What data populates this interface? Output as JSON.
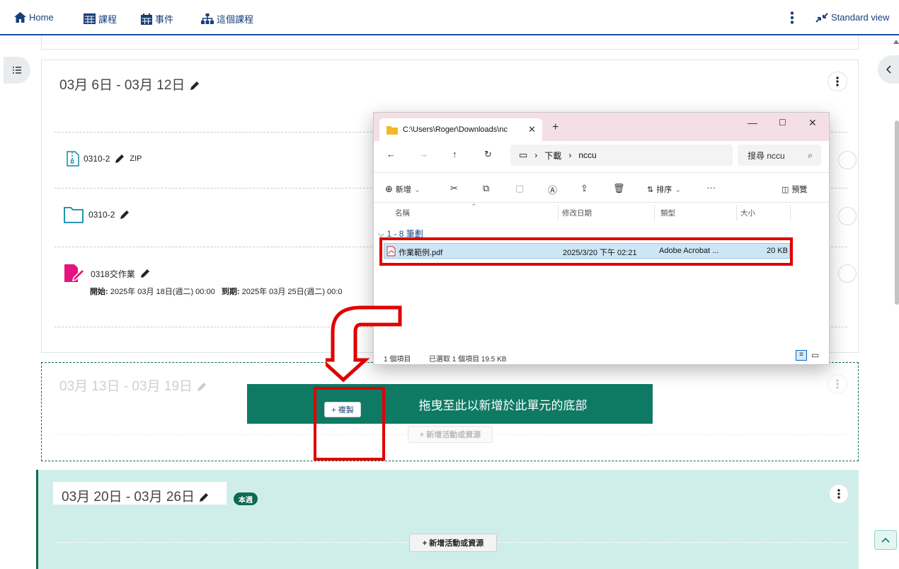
{
  "nav": {
    "home": "Home",
    "courses": "課程",
    "events": "事件",
    "this_course": "這個課程",
    "standard_view": "Standard view"
  },
  "sections": {
    "s1": {
      "title": "03月 6日 - 03月 12日",
      "activities": [
        {
          "name": "0310-2",
          "badge": "ZIP"
        },
        {
          "name": "0310-2"
        },
        {
          "name": "0318交作業",
          "start_label": "開始:",
          "start_value": "2025年 03月 18日(週二) 00:00",
          "due_label": "到期:",
          "due_value": "2025年 03月 25日(週二) 00:0"
        }
      ]
    },
    "s2": {
      "title": "03月 13日 - 03月 19日",
      "drop_text": "拖曳至此以新增於此單元的底部",
      "copy_label": "+ 複製",
      "add_label": "+ 新增活動或資源"
    },
    "s3": {
      "title": "03月 20日 - 03月 26日",
      "badge": "本週",
      "add_label": "+ 新增活動或資源"
    }
  },
  "explorer": {
    "tab_title": "C:\\Users\\Roger\\Downloads\\nc",
    "path": [
      "下載",
      "nccu"
    ],
    "search_placeholder": "搜尋 nccu",
    "new_label": "新增",
    "sort_label": "排序",
    "preview_label": "預覽",
    "columns": {
      "name": "名稱",
      "modified": "修改日期",
      "type": "類型",
      "size": "大小"
    },
    "group": "1 - 8 筆劃",
    "file": {
      "name": "作業範例.pdf",
      "modified": "2025/3/20 下午 02:21",
      "type": "Adobe Acrobat ...",
      "size": "20 KB"
    },
    "status_count": "1 個項目",
    "status_selected": "已選取 1 個項目  19.5 KB"
  },
  "colors": {
    "accent": "#1f4d9c",
    "green": "#0e7a64",
    "highlight": "#e00000",
    "current_week_bg": "#cfeeea"
  }
}
